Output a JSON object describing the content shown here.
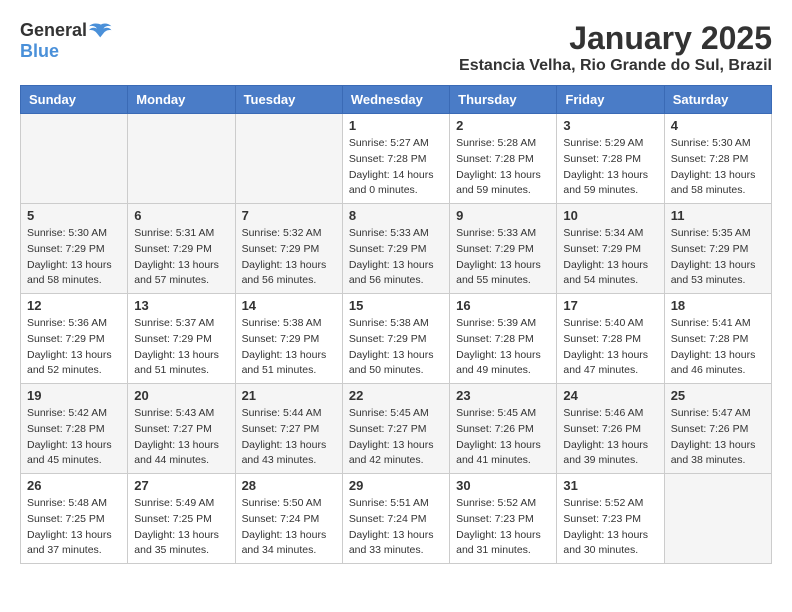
{
  "header": {
    "logo": {
      "text_general": "General",
      "text_blue": "Blue"
    },
    "title": "January 2025",
    "subtitle": "Estancia Velha, Rio Grande do Sul, Brazil"
  },
  "calendar": {
    "headers": [
      "Sunday",
      "Monday",
      "Tuesday",
      "Wednesday",
      "Thursday",
      "Friday",
      "Saturday"
    ],
    "weeks": [
      [
        {
          "day": "",
          "info": ""
        },
        {
          "day": "",
          "info": ""
        },
        {
          "day": "",
          "info": ""
        },
        {
          "day": "1",
          "info": "Sunrise: 5:27 AM\nSunset: 7:28 PM\nDaylight: 14 hours\nand 0 minutes."
        },
        {
          "day": "2",
          "info": "Sunrise: 5:28 AM\nSunset: 7:28 PM\nDaylight: 13 hours\nand 59 minutes."
        },
        {
          "day": "3",
          "info": "Sunrise: 5:29 AM\nSunset: 7:28 PM\nDaylight: 13 hours\nand 59 minutes."
        },
        {
          "day": "4",
          "info": "Sunrise: 5:30 AM\nSunset: 7:28 PM\nDaylight: 13 hours\nand 58 minutes."
        }
      ],
      [
        {
          "day": "5",
          "info": "Sunrise: 5:30 AM\nSunset: 7:29 PM\nDaylight: 13 hours\nand 58 minutes."
        },
        {
          "day": "6",
          "info": "Sunrise: 5:31 AM\nSunset: 7:29 PM\nDaylight: 13 hours\nand 57 minutes."
        },
        {
          "day": "7",
          "info": "Sunrise: 5:32 AM\nSunset: 7:29 PM\nDaylight: 13 hours\nand 56 minutes."
        },
        {
          "day": "8",
          "info": "Sunrise: 5:33 AM\nSunset: 7:29 PM\nDaylight: 13 hours\nand 56 minutes."
        },
        {
          "day": "9",
          "info": "Sunrise: 5:33 AM\nSunset: 7:29 PM\nDaylight: 13 hours\nand 55 minutes."
        },
        {
          "day": "10",
          "info": "Sunrise: 5:34 AM\nSunset: 7:29 PM\nDaylight: 13 hours\nand 54 minutes."
        },
        {
          "day": "11",
          "info": "Sunrise: 5:35 AM\nSunset: 7:29 PM\nDaylight: 13 hours\nand 53 minutes."
        }
      ],
      [
        {
          "day": "12",
          "info": "Sunrise: 5:36 AM\nSunset: 7:29 PM\nDaylight: 13 hours\nand 52 minutes."
        },
        {
          "day": "13",
          "info": "Sunrise: 5:37 AM\nSunset: 7:29 PM\nDaylight: 13 hours\nand 51 minutes."
        },
        {
          "day": "14",
          "info": "Sunrise: 5:38 AM\nSunset: 7:29 PM\nDaylight: 13 hours\nand 51 minutes."
        },
        {
          "day": "15",
          "info": "Sunrise: 5:38 AM\nSunset: 7:29 PM\nDaylight: 13 hours\nand 50 minutes."
        },
        {
          "day": "16",
          "info": "Sunrise: 5:39 AM\nSunset: 7:28 PM\nDaylight: 13 hours\nand 49 minutes."
        },
        {
          "day": "17",
          "info": "Sunrise: 5:40 AM\nSunset: 7:28 PM\nDaylight: 13 hours\nand 47 minutes."
        },
        {
          "day": "18",
          "info": "Sunrise: 5:41 AM\nSunset: 7:28 PM\nDaylight: 13 hours\nand 46 minutes."
        }
      ],
      [
        {
          "day": "19",
          "info": "Sunrise: 5:42 AM\nSunset: 7:28 PM\nDaylight: 13 hours\nand 45 minutes."
        },
        {
          "day": "20",
          "info": "Sunrise: 5:43 AM\nSunset: 7:27 PM\nDaylight: 13 hours\nand 44 minutes."
        },
        {
          "day": "21",
          "info": "Sunrise: 5:44 AM\nSunset: 7:27 PM\nDaylight: 13 hours\nand 43 minutes."
        },
        {
          "day": "22",
          "info": "Sunrise: 5:45 AM\nSunset: 7:27 PM\nDaylight: 13 hours\nand 42 minutes."
        },
        {
          "day": "23",
          "info": "Sunrise: 5:45 AM\nSunset: 7:26 PM\nDaylight: 13 hours\nand 41 minutes."
        },
        {
          "day": "24",
          "info": "Sunrise: 5:46 AM\nSunset: 7:26 PM\nDaylight: 13 hours\nand 39 minutes."
        },
        {
          "day": "25",
          "info": "Sunrise: 5:47 AM\nSunset: 7:26 PM\nDaylight: 13 hours\nand 38 minutes."
        }
      ],
      [
        {
          "day": "26",
          "info": "Sunrise: 5:48 AM\nSunset: 7:25 PM\nDaylight: 13 hours\nand 37 minutes."
        },
        {
          "day": "27",
          "info": "Sunrise: 5:49 AM\nSunset: 7:25 PM\nDaylight: 13 hours\nand 35 minutes."
        },
        {
          "day": "28",
          "info": "Sunrise: 5:50 AM\nSunset: 7:24 PM\nDaylight: 13 hours\nand 34 minutes."
        },
        {
          "day": "29",
          "info": "Sunrise: 5:51 AM\nSunset: 7:24 PM\nDaylight: 13 hours\nand 33 minutes."
        },
        {
          "day": "30",
          "info": "Sunrise: 5:52 AM\nSunset: 7:23 PM\nDaylight: 13 hours\nand 31 minutes."
        },
        {
          "day": "31",
          "info": "Sunrise: 5:52 AM\nSunset: 7:23 PM\nDaylight: 13 hours\nand 30 minutes."
        },
        {
          "day": "",
          "info": ""
        }
      ]
    ]
  }
}
